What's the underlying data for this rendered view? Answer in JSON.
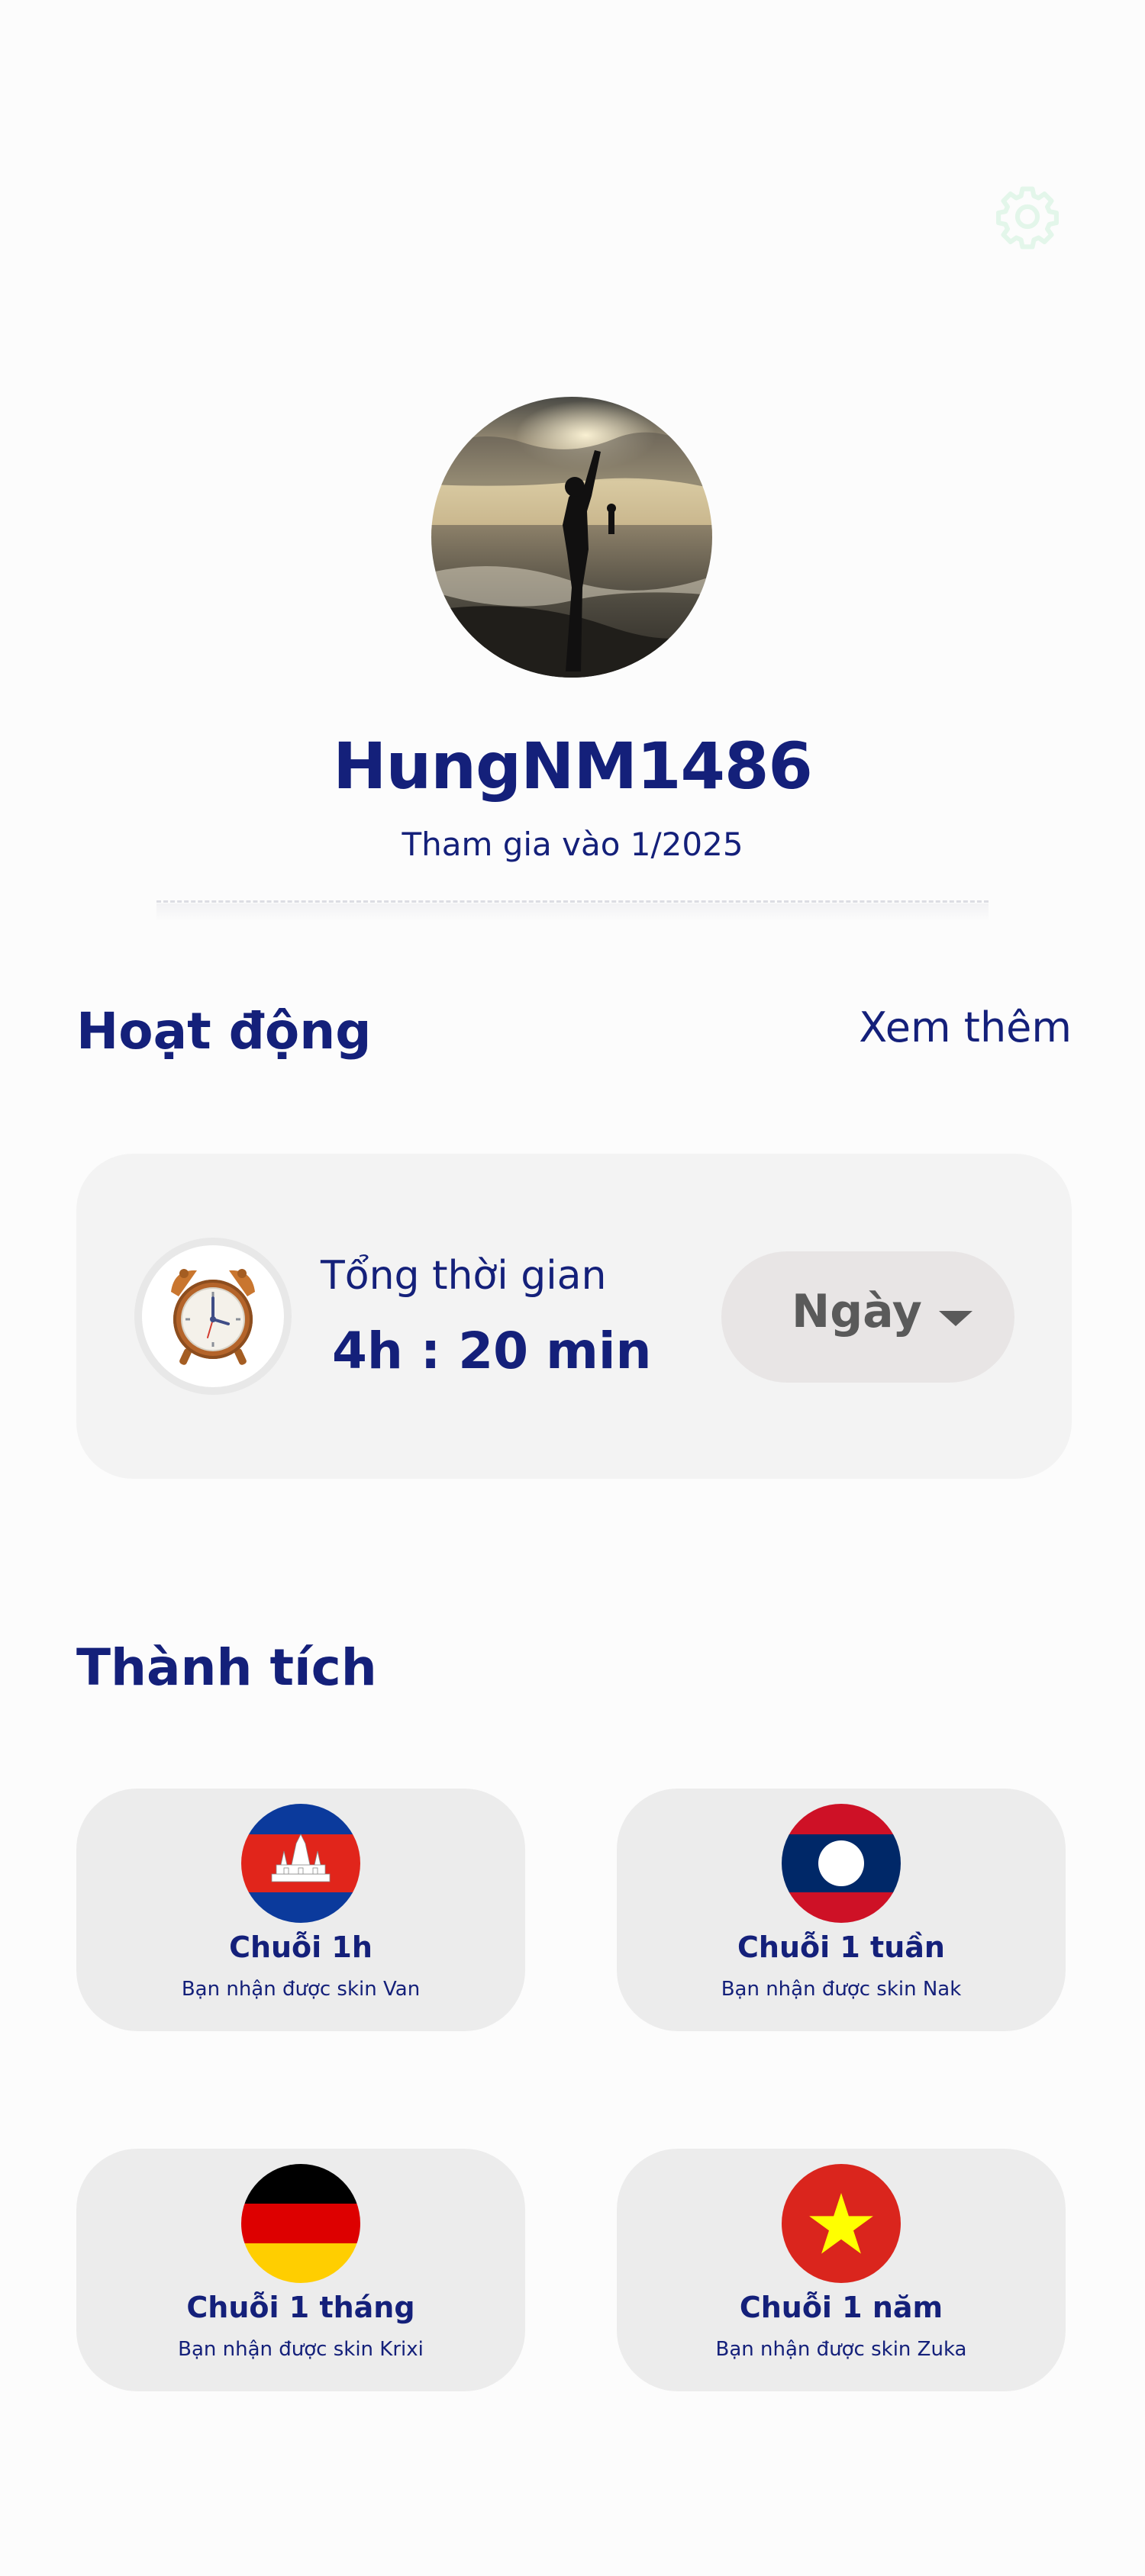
{
  "icons": {
    "settings": "gear-icon",
    "timer": "alarm-clock-icon",
    "dropdown": "chevron-down-icon"
  },
  "colors": {
    "primary_text": "#14207a",
    "card_bg": "#f3f3f3",
    "achievement_bg": "#ececec",
    "select_bg": "#e8e5e5",
    "settings_icon": "#e3f6ea"
  },
  "profile": {
    "username": "HungNM1486",
    "joined": "Tham gia vào 1/2025"
  },
  "activity": {
    "title": "Hoạt động",
    "see_more": "Xem thêm",
    "total_label": "Tổng thời gian",
    "total_value": "4h : 20 min",
    "period": "Ngày"
  },
  "achievements": {
    "title": "Thành tích",
    "items": [
      {
        "title": "Chuỗi 1h",
        "desc": "Bạn nhận được skin Van",
        "flag": "cambodia-flag-icon"
      },
      {
        "title": "Chuỗi 1 tuần",
        "desc": "Bạn nhận được skin Nak",
        "flag": "laos-flag-icon"
      },
      {
        "title": "Chuỗi 1 tháng",
        "desc": "Bạn nhận được skin Krixi",
        "flag": "germany-flag-icon"
      },
      {
        "title": "Chuỗi 1 năm",
        "desc": "Bạn nhận được skin Zuka",
        "flag": "vietnam-flag-icon"
      }
    ]
  }
}
